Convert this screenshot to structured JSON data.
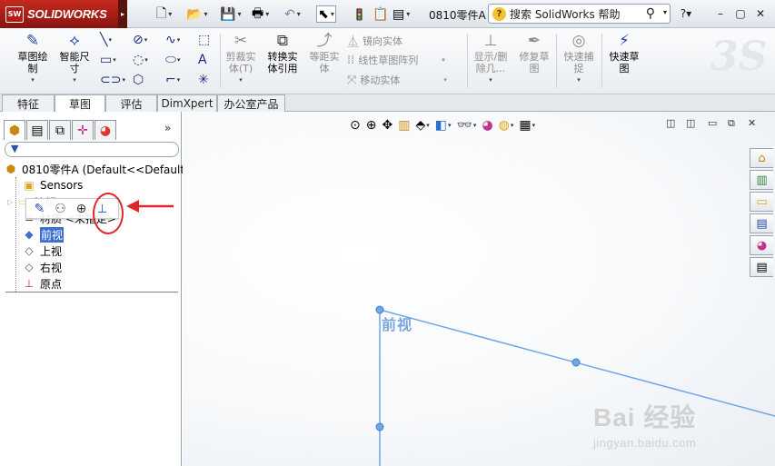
{
  "app": {
    "logo_text": "SOLIDWORKS",
    "logo_badge": "SW"
  },
  "titlebar": {
    "document_title": "0810零件A",
    "help_search_placeholder": "搜索 SolidWorks 帮助",
    "icons": [
      "new-document-icon",
      "open-icon",
      "save-icon",
      "print-icon",
      "undo-icon",
      "select-icon",
      "rebuild-icon",
      "file-properties-icon",
      "options-icon",
      "help-icon",
      "minimize-icon",
      "restore-icon",
      "close-icon"
    ]
  },
  "command_manager": {
    "sketch_label": "草图绘\n制",
    "smart_dim_label": "智能尺\n寸",
    "trim_label": "剪裁实\n体(T)",
    "convert_label": "转换实\n体引用",
    "offset_label": "等距实\n体",
    "mirror_label": "镜向实体",
    "linear_pattern_label": "线性草图阵列",
    "move_label": "移动实体",
    "display_delete_label": "显示/删\n除几...",
    "repair_label": "修复草\n图",
    "quick_snap_label": "快速捕\n捉",
    "rapid_sketch_label": "快速草\n图"
  },
  "tabs": [
    "特征",
    "草图",
    "评估",
    "DimXpert",
    "办公室产品"
  ],
  "active_tab": "草图",
  "feature_tree": {
    "filter_icon": "filter-icon",
    "more_symbol": "»",
    "items": [
      {
        "label": "0810零件A  (Default<<Default",
        "icon": "part-icon"
      },
      {
        "label": "Sensors",
        "icon": "sensors-folder-icon"
      },
      {
        "label": "注解",
        "icon": "annotations-folder-icon"
      },
      {
        "label": "材质 <未指定>",
        "icon": "material-icon"
      },
      {
        "label": "前视",
        "icon": "plane-icon",
        "selected": true
      },
      {
        "label": "上视",
        "icon": "plane-icon"
      },
      {
        "label": "右视",
        "icon": "plane-icon"
      },
      {
        "label": "原点",
        "icon": "origin-icon"
      }
    ]
  },
  "context_toolbar": {
    "buttons": [
      "edit-sketch-icon",
      "show-hide-icon",
      "zoom-to-selection-icon",
      "normal-to-icon"
    ]
  },
  "graphics": {
    "plane_label": "前视",
    "heads_up_icons": [
      "zoom-to-fit-icon",
      "zoom-area-icon",
      "previous-view-icon",
      "section-view-icon",
      "view-orientation-icon",
      "display-style-icon",
      "hide-show-items-icon",
      "edit-appearance-icon",
      "apply-scene-icon",
      "view-settings-icon"
    ],
    "taskpane_icons": [
      "resources-icon",
      "design-library-icon",
      "file-explorer-icon",
      "view-palette-icon",
      "appearances-icon",
      "custom-properties-icon"
    ],
    "plane_color": "#6ea6e8"
  },
  "watermark": {
    "brand": "Bai 经验",
    "url": "jingyan.baidu.com"
  },
  "annotation": {
    "highlight_color": "#e0262a"
  }
}
